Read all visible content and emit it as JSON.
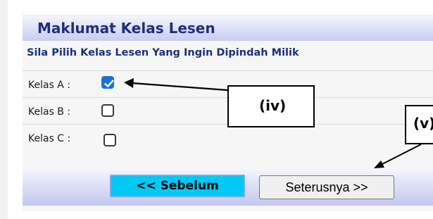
{
  "panel": {
    "title": "Maklumat Kelas Lesen",
    "subtitle": "Sila Pilih Kelas Lesen Yang Ingin Dipindah Milik"
  },
  "license_classes": [
    {
      "label": "Kelas A :",
      "checked": true
    },
    {
      "label": "Kelas B :",
      "checked": false
    },
    {
      "label": "Kelas C :",
      "checked": false
    }
  ],
  "buttons": {
    "previous": "<< Sebelum",
    "next": "Seterusnya >>"
  },
  "annotations": {
    "callout_iv": "(iv)",
    "callout_v": "(v)"
  },
  "colors": {
    "header_text": "#1c2f80",
    "checkbox_checked": "#1a73d8",
    "previous_button": "#00c9f4"
  }
}
